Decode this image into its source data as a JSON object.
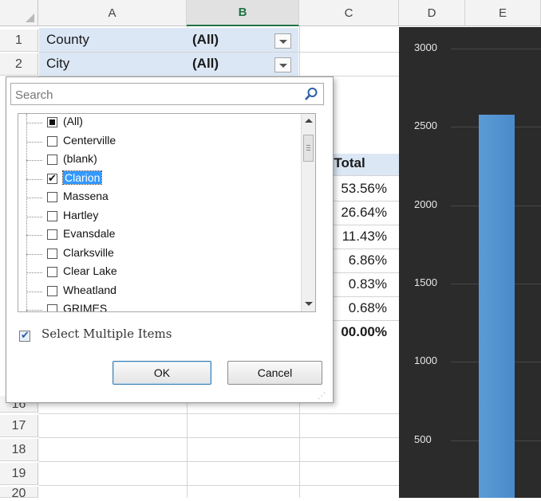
{
  "columns": [
    "A",
    "B",
    "C",
    "D",
    "E"
  ],
  "rows": [
    "1",
    "2",
    "16",
    "17",
    "18",
    "19",
    "20"
  ],
  "pivot_filters": [
    {
      "label": "County",
      "value": "(All)"
    },
    {
      "label": "City",
      "value": "(All)"
    }
  ],
  "pct_header": "f Total",
  "pct_values": [
    "53.56%",
    "26.64%",
    "11.43%",
    "6.86%",
    "0.83%",
    "0.68%",
    "00.00%"
  ],
  "filter": {
    "search_placeholder": "Search",
    "items": [
      {
        "label": "(All)",
        "state": "partial"
      },
      {
        "label": "Centerville",
        "state": "unchecked"
      },
      {
        "label": "(blank)",
        "state": "unchecked"
      },
      {
        "label": "Clarion",
        "state": "checked"
      },
      {
        "label": "Massena",
        "state": "unchecked"
      },
      {
        "label": "Hartley",
        "state": "unchecked"
      },
      {
        "label": "Evansdale",
        "state": "unchecked"
      },
      {
        "label": "Clarksville",
        "state": "unchecked"
      },
      {
        "label": "Clear Lake",
        "state": "unchecked"
      },
      {
        "label": "Wheatland",
        "state": "unchecked"
      },
      {
        "label": "GRIMES",
        "state": "unchecked"
      }
    ],
    "multi_select_label": "Select Multiple Items",
    "ok_label": "OK",
    "cancel_label": "Cancel"
  },
  "chart_data": {
    "type": "bar",
    "yticks": [
      "3000",
      "2500",
      "2000",
      "1500",
      "1000",
      "500"
    ],
    "ylim": [
      0,
      3000
    ],
    "values": [
      2580
    ],
    "bar_color": "#5b9bd5",
    "background": "#2b2b2b"
  }
}
